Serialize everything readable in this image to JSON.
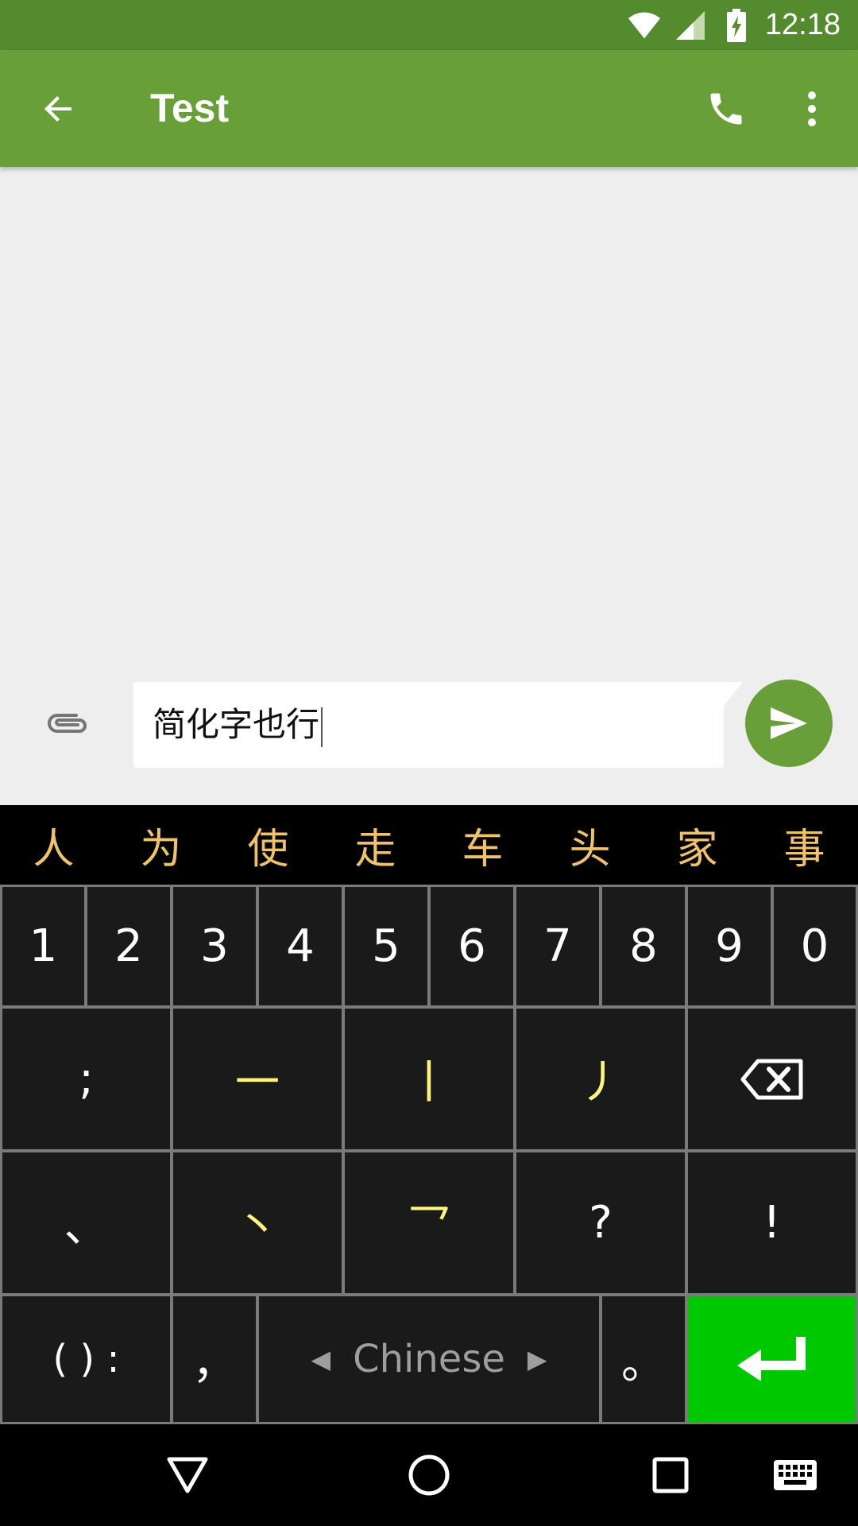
{
  "status_bar": {
    "time": "12:18",
    "icons": [
      "wifi-icon",
      "signal-icon",
      "battery-charging-icon"
    ]
  },
  "app_bar": {
    "title": "Test",
    "icons": [
      "back-arrow-icon",
      "phone-icon",
      "more-vert-icon"
    ]
  },
  "compose": {
    "text": "简化字也行",
    "attach_icon": "paperclip-icon",
    "send_icon": "send-icon"
  },
  "keyboard": {
    "candidates": [
      "人",
      "为",
      "使",
      "走",
      "车",
      "头",
      "家",
      "事"
    ],
    "number_row": [
      "1",
      "2",
      "3",
      "4",
      "5",
      "6",
      "7",
      "8",
      "9",
      "0"
    ],
    "row2": [
      ";",
      "一",
      "丨",
      "丿",
      "backspace-icon"
    ],
    "row3": [
      "、",
      "丶",
      "乛",
      "?",
      "!"
    ],
    "row4": {
      "paren_colon": "( ) :",
      "comma": "，",
      "space_label": "Chinese",
      "period": "。",
      "enter_icon": "enter-icon"
    },
    "colors": {
      "candidate": "#f0c36a",
      "stroke_key": "#fff57a",
      "enter": "#00c800"
    }
  },
  "nav_bar": {
    "icons": [
      "back-triangle-icon",
      "home-circle-icon",
      "recents-square-icon",
      "keyboard-icon"
    ]
  },
  "colors": {
    "status_bar": "#558b2f",
    "app_bar": "#689f38",
    "background": "#eeeeee"
  }
}
